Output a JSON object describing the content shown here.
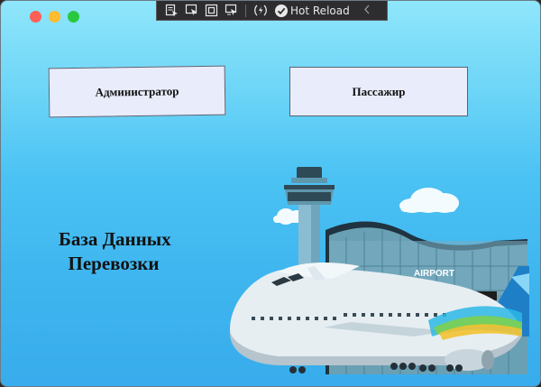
{
  "toolbar": {
    "hot_reload_label": "Hot Reload",
    "icons": [
      "select-element-icon",
      "pointer-icon",
      "layout-adorner-icon",
      "track-focus-icon",
      "hot-reload-settings-icon",
      "check-icon",
      "collapse-chevron-icon"
    ]
  },
  "buttons": {
    "admin_label": "Администратор",
    "passenger_label": "Пассажир"
  },
  "main": {
    "title": "База Данных\n  Перевозки"
  },
  "illustration": {
    "airport_sign": "AIRPORT"
  },
  "colors": {
    "background_top": "#8fe6fb",
    "background_bottom": "#38acec",
    "button_bg": "#e9ecfb"
  }
}
